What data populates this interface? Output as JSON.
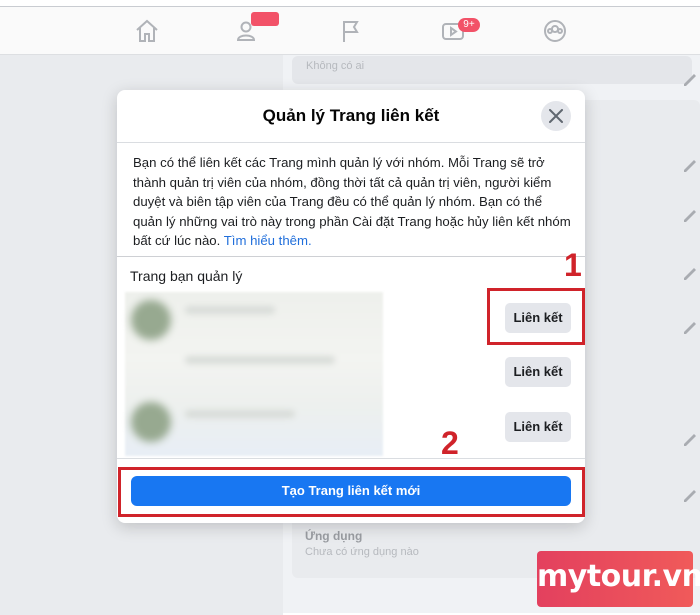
{
  "background": {
    "card1_text": "Không có ai",
    "card2_title": "Ứng dụng",
    "card2_text": "Chưa có ứng dụng nào"
  },
  "topbar": {
    "icons": [
      "home-icon",
      "friends-icon",
      "flag-icon",
      "watch-icon",
      "groups-icon"
    ],
    "watch_badge": "9+"
  },
  "dialog": {
    "title": "Quản lý Trang liên kết",
    "description": "Bạn có thể liên kết các Trang mình quản lý với nhóm. Mỗi Trang sẽ trở thành quản trị viên của nhóm, đồng thời tất cả quản trị viên, người kiểm duyệt và biên tập viên của Trang đều có thể quản lý nhóm. Bạn có thể quản lý những vai trò này trong phần Cài đặt Trang hoặc hủy liên kết nhóm bất cứ lúc nào.",
    "learn_more": "Tìm hiểu thêm.",
    "section_label": "Trang bạn quản lý",
    "pages": [
      {
        "button": "Liên kết"
      },
      {
        "button": "Liên kết"
      },
      {
        "button": "Liên kết"
      }
    ],
    "create_button": "Tạo Trang liên kết mới"
  },
  "annotations": {
    "step1": "1",
    "step2": "2",
    "color": "#d0232a"
  },
  "watermark": "mytour.vn"
}
